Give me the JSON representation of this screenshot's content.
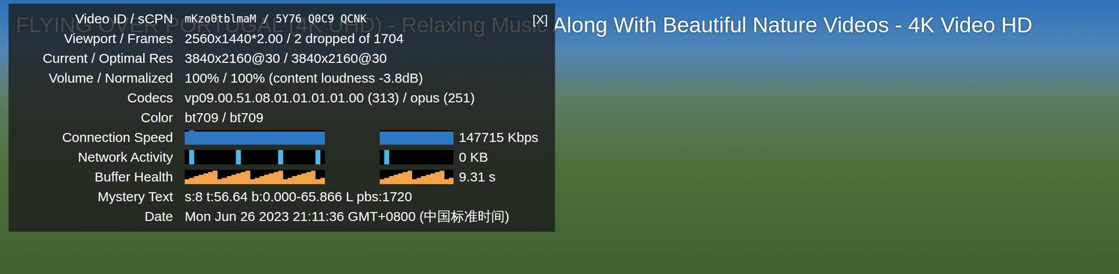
{
  "video": {
    "title": "FLYING OVER PORTUGAL (4K UHD) - Relaxing Music Along With Beautiful Nature Videos - 4K Video HD"
  },
  "panel": {
    "close": "[X]",
    "rows": [
      {
        "label": "Video ID / sCPN",
        "value": "mKzo0tblmaM / 5Y76 Q0C9 QCNK",
        "kind": "text"
      },
      {
        "label": "Viewport / Frames",
        "value": "2560x1440*2.00 / 2 dropped of 1704",
        "kind": "text"
      },
      {
        "label": "Current / Optimal Res",
        "value": "3840x2160@30 / 3840x2160@30",
        "kind": "text"
      },
      {
        "label": "Volume / Normalized",
        "value": "100% / 100% (content loudness -3.8dB)",
        "kind": "text"
      },
      {
        "label": "Codecs",
        "value": "vp09.00.51.08.01.01.01.01.00 (313) / opus (251)",
        "kind": "text"
      },
      {
        "label": "Color",
        "value": "bt709 / bt709",
        "kind": "text"
      },
      {
        "label": "Connection Speed",
        "value": "147715 Kbps",
        "kind": "graph",
        "color": "#2f78c4",
        "series": [
          [
            0.9,
            1.0,
            0.9,
            0.9,
            0.9,
            0.9,
            0.9,
            0.9,
            0.9,
            0.9,
            0.9,
            0.9,
            0.9,
            0.9,
            0.9,
            0.9,
            0.9,
            0.9,
            0.9,
            0.9,
            0.9,
            0.9,
            0.9,
            0.9,
            0.9,
            0.9,
            0.9,
            0.9,
            0.9,
            0.9
          ],
          [
            0.9,
            0.9,
            0.9,
            0.9,
            0.9,
            0.9,
            0.9,
            0.9,
            0.9,
            0.9,
            0.9,
            0.9,
            0.9,
            0.9,
            0.9,
            0.9
          ]
        ]
      },
      {
        "label": "Network Activity",
        "value": "0 KB",
        "kind": "graph",
        "color": "#4fb6e8",
        "series": [
          [
            0,
            1,
            0,
            0,
            0,
            0,
            0,
            0,
            0,
            0,
            0,
            1,
            0,
            0,
            0,
            0,
            0,
            0,
            0,
            0,
            1,
            0,
            0,
            0,
            0,
            0,
            0,
            0,
            1,
            0
          ],
          [
            0,
            1,
            0,
            0,
            0,
            0,
            0,
            0,
            0,
            0,
            0,
            0,
            0,
            0,
            0,
            0
          ]
        ]
      },
      {
        "label": "Buffer Health",
        "value": "9.31 s",
        "kind": "graph",
        "color": "#f5a34a",
        "series": [
          [
            0.35,
            0.45,
            0.55,
            0.65,
            0.75,
            0.85,
            0.95,
            0.35,
            0.45,
            0.55,
            0.65,
            0.75,
            0.85,
            0.95,
            0.35,
            0.45,
            0.55,
            0.65,
            0.75,
            0.85,
            0.95,
            0.35,
            0.45,
            0.55,
            0.65,
            0.75,
            0.85,
            0.95,
            0.35,
            0.45
          ],
          [
            0.35,
            0.45,
            0.55,
            0.65,
            0.75,
            0.85,
            0.95,
            0.35,
            0.45,
            0.55,
            0.65,
            0.75,
            0.85,
            0.95,
            0.35,
            0.45
          ]
        ]
      },
      {
        "label": "Mystery Text",
        "value": "s:8 t:56.64 b:0.000-65.866 L pbs:1720",
        "kind": "text"
      },
      {
        "label": "Date",
        "value": "Mon Jun 26 2023 21:11:36 GMT+0800 (中国标准时间)",
        "kind": "text"
      }
    ]
  }
}
